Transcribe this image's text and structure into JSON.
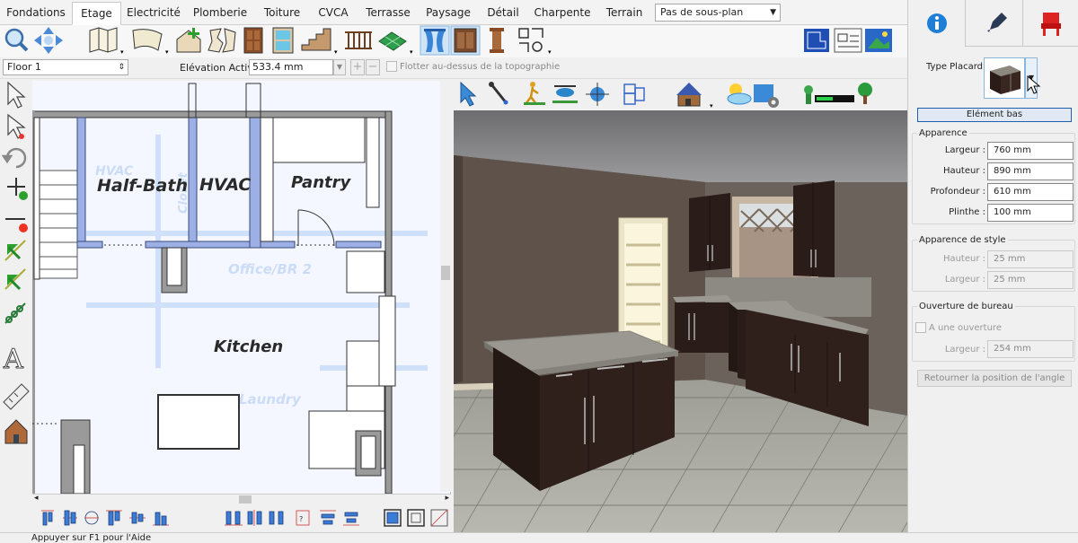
{
  "tabs": [
    "Fondations",
    "Etage",
    "Electricité",
    "Plomberie",
    "Toiture",
    "CVCA",
    "Terrasse",
    "Paysage",
    "Détail",
    "Charpente",
    "Terrain"
  ],
  "active_tab": "Etage",
  "subplan_select": "Pas de sous-plan",
  "floor_select": "Floor 1",
  "elevation": {
    "label": "Elévation Active:",
    "value": "533.4 mm"
  },
  "float_label": "Flotter au-dessus de la topographie",
  "plan": {
    "rooms": [
      "Half-Bath",
      "HVAC",
      "Pantry",
      "Kitchen"
    ],
    "ghost_rooms": [
      "HVAC",
      "Closet",
      "Office/BR 2",
      "Laundry"
    ]
  },
  "status_text": "Appuyer sur F1 pour l'Aide",
  "panel": {
    "type_label": "Type Placard:",
    "type_button": "Elément bas",
    "appearance": {
      "title": "Apparence",
      "width_label": "Largeur :",
      "width": "760 mm",
      "height_label": "Hauteur :",
      "height": "890 mm",
      "depth_label": "Profondeur :",
      "depth": "610 mm",
      "plinth_label": "Plinthe :",
      "plinth": "100 mm"
    },
    "style": {
      "title": "Apparence de style",
      "height_label": "Hauteur :",
      "height": "25 mm",
      "width_label": "Largeur :",
      "width": "25 mm"
    },
    "opening": {
      "title": "Ouverture de bureau",
      "checkbox_label": "A une ouverture",
      "width_label": "Largeur :",
      "width": "254 mm"
    },
    "reset_button": "Retourner la position de l'angle"
  },
  "colors": {
    "accent": "#1e7fd8",
    "wall": "#9aa9d6",
    "cabinet": "#2a1c18",
    "countertop": "#9b9892"
  }
}
